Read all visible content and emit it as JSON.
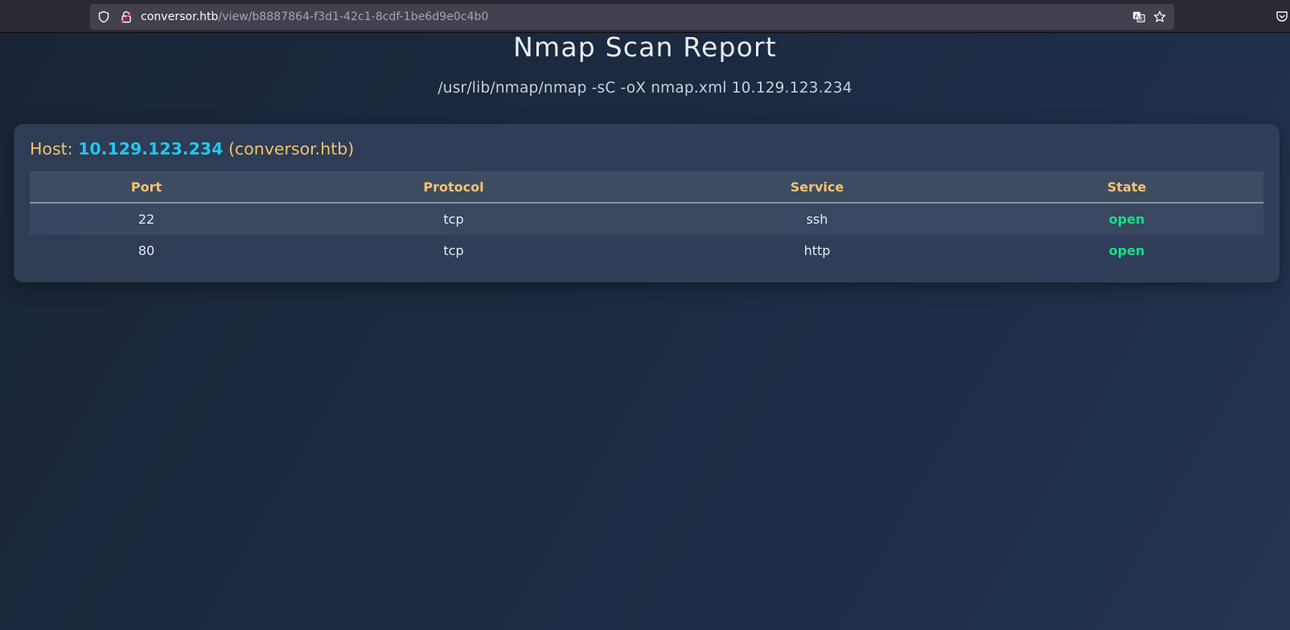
{
  "browser": {
    "url_host": "conversor.htb",
    "url_path": "/view/b8887864-f3d1-42c1-8cdf-1be6d9e0c4b0",
    "icons": [
      "shield-icon",
      "lock-icon",
      "translate-icon",
      "star-icon",
      "pocket-icon"
    ]
  },
  "report": {
    "title": "Nmap Scan Report",
    "command": "/usr/lib/nmap/nmap -sC -oX nmap.xml 10.129.123.234"
  },
  "host": {
    "label": "Host:",
    "ip": "10.129.123.234",
    "hostname": "(conversor.htb)"
  },
  "table": {
    "headers": [
      "Port",
      "Protocol",
      "Service",
      "State"
    ],
    "rows": [
      [
        "22",
        "tcp",
        "ssh",
        "open"
      ],
      [
        "80",
        "tcp",
        "http",
        "open"
      ]
    ]
  },
  "colors": {
    "accent_heading": "#f2c26b",
    "ip_color": "#22c7ee",
    "state_open": "#12e089",
    "card_bg": "#34435c"
  }
}
